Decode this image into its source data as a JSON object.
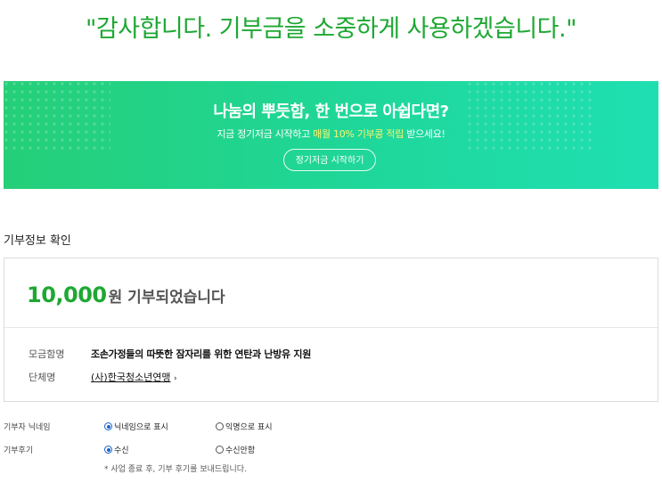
{
  "header": {
    "thanks_message": "\"감사합니다. 기부금을 소중하게 사용하겠습니다.\""
  },
  "banner": {
    "title": "나눔의 뿌듯함, 한 번으로 아쉽다면?",
    "subtitle_prefix": "지금 정기저금 시작하고 ",
    "subtitle_highlight": "매월 10% 기부콩 적립",
    "subtitle_suffix": " 받으세요!",
    "button_label": "정기저금 시작하기",
    "colors": {
      "gradient_start": "#25cf78",
      "gradient_end": "#1fdfb2",
      "highlight": "#fff36a"
    }
  },
  "donation_info": {
    "section_title": "기부정보 확인",
    "amount": "10,000",
    "amount_suffix": "원 기부되었습니다",
    "fundraising_label": "모금함명",
    "fundraising_value": "조손가정들의 따뜻한 잠자리를 위한 연탄과 난방유 지원",
    "organization_label": "단체명",
    "organization_value": "(사)한국청소년연맹",
    "colors": {
      "accent": "#1ea833"
    }
  },
  "options": {
    "nickname": {
      "label": "기부자 닉네임",
      "choices": [
        {
          "label": "닉네임으로 표시",
          "selected": true
        },
        {
          "label": "익명으로 표시",
          "selected": false
        }
      ]
    },
    "review": {
      "label": "기부후기",
      "choices": [
        {
          "label": "수신",
          "selected": true
        },
        {
          "label": "수신안함",
          "selected": false
        }
      ],
      "note": "* 사업 종료 후, 기부 후기를 보내드립니다."
    }
  }
}
